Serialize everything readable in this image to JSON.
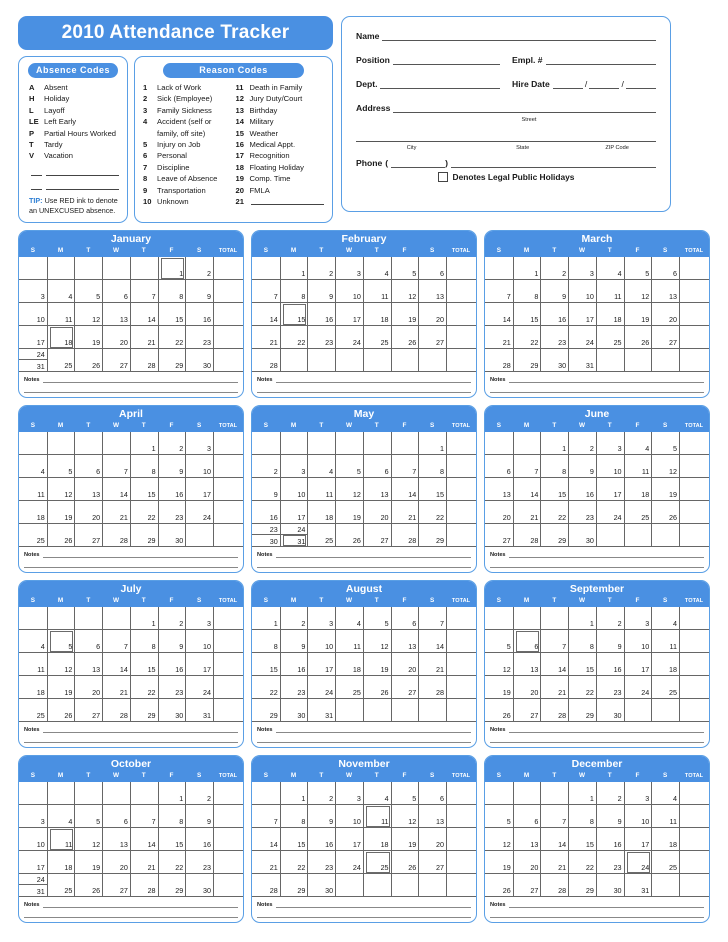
{
  "header": {
    "title": "2010 Attendance Tracker"
  },
  "absence_codes": {
    "heading": "Absence Codes",
    "items": [
      {
        "code": "A",
        "label": "Absent"
      },
      {
        "code": "H",
        "label": "Holiday"
      },
      {
        "code": "L",
        "label": "Layoff"
      },
      {
        "code": "LE",
        "label": "Left Early"
      },
      {
        "code": "P",
        "label": "Partial Hours Worked"
      },
      {
        "code": "T",
        "label": "Tardy"
      },
      {
        "code": "V",
        "label": "Vacation"
      }
    ],
    "tip_label": "TIP:",
    "tip_text": " Use RED ink to denote an UNEXCUSED absence."
  },
  "reason_codes": {
    "heading": "Reason Codes",
    "col1": [
      {
        "num": "1",
        "label": "Lack of Work"
      },
      {
        "num": "2",
        "label": "Sick (Employee)"
      },
      {
        "num": "3",
        "label": "Family Sickness"
      },
      {
        "num": "4",
        "label": "Accident (self or"
      },
      {
        "num": "",
        "label": "family, off site)"
      },
      {
        "num": "5",
        "label": "Injury on Job"
      },
      {
        "num": "6",
        "label": "Personal"
      },
      {
        "num": "7",
        "label": "Discipline"
      },
      {
        "num": "8",
        "label": "Leave of Absence"
      },
      {
        "num": "9",
        "label": "Transportation"
      },
      {
        "num": "10",
        "label": "Unknown"
      }
    ],
    "col2": [
      {
        "num": "11",
        "label": "Death in Family"
      },
      {
        "num": "12",
        "label": "Jury Duty/Court"
      },
      {
        "num": "13",
        "label": "Birthday"
      },
      {
        "num": "14",
        "label": "Military"
      },
      {
        "num": "15",
        "label": "Weather"
      },
      {
        "num": "16",
        "label": "Medical Appt."
      },
      {
        "num": "17",
        "label": "Recognition"
      },
      {
        "num": "18",
        "label": "Floating Holiday"
      },
      {
        "num": "19",
        "label": "Comp. Time"
      },
      {
        "num": "20",
        "label": "FMLA"
      },
      {
        "num": "21",
        "label": ""
      }
    ]
  },
  "employee_info": {
    "name_label": "Name",
    "position_label": "Position",
    "empl_num_label": "Empl. #",
    "dept_label": "Dept.",
    "hire_date_label": "Hire Date",
    "address_label": "Address",
    "street_sub": "Street",
    "city_sub": "City",
    "state_sub": "State",
    "zip_sub": "ZIP Code",
    "phone_label": "Phone",
    "holiday_note": "Denotes Legal Public Holidays",
    "name_value": "",
    "position_value": "",
    "empl_num_value": "",
    "dept_value": "",
    "hire_date_value": "",
    "address_value": "",
    "city_value": "",
    "state_value": "",
    "zip_value": "",
    "phone_value": ""
  },
  "calendar": {
    "year": "2010",
    "dow": [
      "S",
      "M",
      "T",
      "W",
      "T",
      "F",
      "S"
    ],
    "total_label": "TOTAL",
    "notes_label": "Notes",
    "accent_color": "#4a90e2",
    "border_color": "#5a9fe5",
    "holiday_box_color": "#6b6b6b",
    "months": [
      {
        "name": "January",
        "weeks": [
          [
            null,
            null,
            null,
            null,
            null,
            1,
            2
          ],
          [
            3,
            4,
            5,
            6,
            7,
            8,
            9
          ],
          [
            10,
            11,
            12,
            13,
            14,
            15,
            16
          ],
          [
            17,
            18,
            19,
            20,
            21,
            22,
            23
          ],
          [
            {
              "split": [
                24,
                31
              ]
            },
            25,
            26,
            27,
            28,
            29,
            30
          ]
        ],
        "holidays": [
          1,
          18
        ]
      },
      {
        "name": "February",
        "weeks": [
          [
            null,
            1,
            2,
            3,
            4,
            5,
            6
          ],
          [
            7,
            8,
            9,
            10,
            11,
            12,
            13
          ],
          [
            14,
            15,
            16,
            17,
            18,
            19,
            20
          ],
          [
            21,
            22,
            23,
            24,
            25,
            26,
            27
          ],
          [
            28,
            null,
            null,
            null,
            null,
            null,
            null
          ]
        ],
        "holidays": [
          15
        ]
      },
      {
        "name": "March",
        "weeks": [
          [
            null,
            1,
            2,
            3,
            4,
            5,
            6
          ],
          [
            7,
            8,
            9,
            10,
            11,
            12,
            13
          ],
          [
            14,
            15,
            16,
            17,
            18,
            19,
            20
          ],
          [
            21,
            22,
            23,
            24,
            25,
            26,
            27
          ],
          [
            28,
            29,
            30,
            31,
            null,
            null,
            null
          ]
        ],
        "holidays": []
      },
      {
        "name": "April",
        "weeks": [
          [
            null,
            null,
            null,
            null,
            1,
            2,
            3
          ],
          [
            4,
            5,
            6,
            7,
            8,
            9,
            10
          ],
          [
            11,
            12,
            13,
            14,
            15,
            16,
            17
          ],
          [
            18,
            19,
            20,
            21,
            22,
            23,
            24
          ],
          [
            25,
            26,
            27,
            28,
            29,
            30,
            null
          ]
        ],
        "holidays": []
      },
      {
        "name": "May",
        "weeks": [
          [
            null,
            null,
            null,
            null,
            null,
            null,
            1
          ],
          [
            2,
            3,
            4,
            5,
            6,
            7,
            8
          ],
          [
            9,
            10,
            11,
            12,
            13,
            14,
            15
          ],
          [
            16,
            17,
            18,
            19,
            20,
            21,
            22
          ],
          [
            {
              "split": [
                23,
                30
              ]
            },
            {
              "split": [
                24,
                31
              ]
            },
            25,
            26,
            27,
            28,
            29
          ]
        ],
        "holidays": [
          31
        ]
      },
      {
        "name": "June",
        "weeks": [
          [
            null,
            null,
            1,
            2,
            3,
            4,
            5
          ],
          [
            6,
            7,
            8,
            9,
            10,
            11,
            12
          ],
          [
            13,
            14,
            15,
            16,
            17,
            18,
            19
          ],
          [
            20,
            21,
            22,
            23,
            24,
            25,
            26
          ],
          [
            27,
            28,
            29,
            30,
            null,
            null,
            null
          ]
        ],
        "holidays": []
      },
      {
        "name": "July",
        "weeks": [
          [
            null,
            null,
            null,
            null,
            1,
            2,
            3
          ],
          [
            4,
            5,
            6,
            7,
            8,
            9,
            10
          ],
          [
            11,
            12,
            13,
            14,
            15,
            16,
            17
          ],
          [
            18,
            19,
            20,
            21,
            22,
            23,
            24
          ],
          [
            25,
            26,
            27,
            28,
            29,
            30,
            31
          ]
        ],
        "holidays": [
          5
        ]
      },
      {
        "name": "August",
        "weeks": [
          [
            1,
            2,
            3,
            4,
            5,
            6,
            7
          ],
          [
            8,
            9,
            10,
            11,
            12,
            13,
            14
          ],
          [
            15,
            16,
            17,
            18,
            19,
            20,
            21
          ],
          [
            22,
            23,
            24,
            25,
            26,
            27,
            28
          ],
          [
            29,
            30,
            31,
            null,
            null,
            null,
            null
          ]
        ],
        "holidays": []
      },
      {
        "name": "September",
        "weeks": [
          [
            null,
            null,
            null,
            1,
            2,
            3,
            4
          ],
          [
            5,
            6,
            7,
            8,
            9,
            10,
            11
          ],
          [
            12,
            13,
            14,
            15,
            16,
            17,
            18
          ],
          [
            19,
            20,
            21,
            22,
            23,
            24,
            25
          ],
          [
            26,
            27,
            28,
            29,
            30,
            null,
            null
          ]
        ],
        "holidays": [
          6
        ]
      },
      {
        "name": "October",
        "weeks": [
          [
            null,
            null,
            null,
            null,
            null,
            1,
            2
          ],
          [
            3,
            4,
            5,
            6,
            7,
            8,
            9
          ],
          [
            10,
            11,
            12,
            13,
            14,
            15,
            16
          ],
          [
            17,
            18,
            19,
            20,
            21,
            22,
            23
          ],
          [
            {
              "split": [
                24,
                31
              ]
            },
            25,
            26,
            27,
            28,
            29,
            30
          ]
        ],
        "holidays": [
          11
        ]
      },
      {
        "name": "November",
        "weeks": [
          [
            null,
            1,
            2,
            3,
            4,
            5,
            6
          ],
          [
            7,
            8,
            9,
            10,
            11,
            12,
            13
          ],
          [
            14,
            15,
            16,
            17,
            18,
            19,
            20
          ],
          [
            21,
            22,
            23,
            24,
            25,
            26,
            27
          ],
          [
            28,
            29,
            30,
            null,
            null,
            null,
            null
          ]
        ],
        "holidays": [
          11,
          25
        ]
      },
      {
        "name": "December",
        "weeks": [
          [
            null,
            null,
            null,
            1,
            2,
            3,
            4
          ],
          [
            5,
            6,
            7,
            8,
            9,
            10,
            11
          ],
          [
            12,
            13,
            14,
            15,
            16,
            17,
            18
          ],
          [
            19,
            20,
            21,
            22,
            23,
            24,
            25
          ],
          [
            26,
            27,
            28,
            29,
            30,
            31,
            null
          ]
        ],
        "holidays": [
          24
        ]
      }
    ]
  }
}
